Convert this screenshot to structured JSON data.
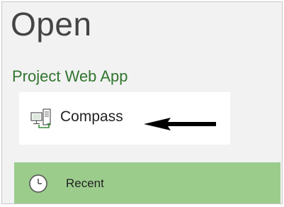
{
  "page": {
    "title": "Open"
  },
  "section": {
    "title": "Project Web App"
  },
  "locations": [
    {
      "label": "Compass",
      "icon": "server-computer-icon"
    }
  ],
  "recent": {
    "label": "Recent",
    "icon": "clock-icon"
  },
  "annotation": {
    "icon": "arrow-left-icon"
  },
  "colors": {
    "title": "#444444",
    "section_title": "#31752f",
    "recent_background": "#9bcc8c",
    "location_background": "#ffffff",
    "panel_background": "#f2f2f2",
    "icon_green": "#3a8a3a",
    "arrow": "#000000"
  }
}
